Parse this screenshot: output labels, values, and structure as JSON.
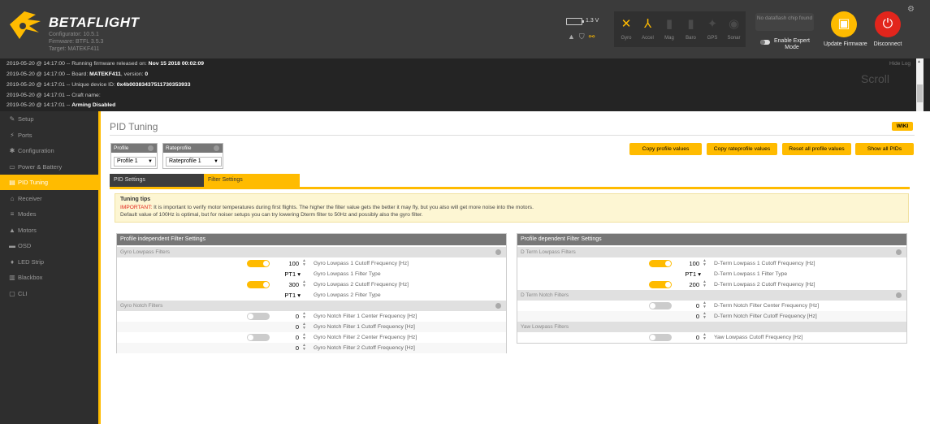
{
  "header": {
    "brand": "BETAFLIGHT",
    "meta": [
      "Configurator: 10.5.1",
      "Firmware: BTFL 3.5.3",
      "Target: MATEKF411"
    ],
    "battery_voltage": "1.3 V",
    "sensors": [
      {
        "label": "Gyro",
        "icon": "gyro-icon",
        "glyph": "✕",
        "active": true
      },
      {
        "label": "Accel",
        "icon": "accel-icon",
        "glyph": "⅄",
        "active": true
      },
      {
        "label": "Mag",
        "icon": "mag-icon",
        "glyph": "▮",
        "active": false
      },
      {
        "label": "Baro",
        "icon": "baro-icon",
        "glyph": "▮",
        "active": false
      },
      {
        "label": "GPS",
        "icon": "gps-icon",
        "glyph": "✦",
        "active": false
      },
      {
        "label": "Sonar",
        "icon": "sonar-icon",
        "glyph": "◉",
        "active": false
      }
    ],
    "dataflash": "No dataflash chip found",
    "expert_mode": "Enable Expert Mode",
    "update_firmware": "Update Firmware",
    "disconnect": "Disconnect"
  },
  "log": {
    "lines": [
      {
        "prefix": "2019-05-20 @ 14:17:00 -- Running firmware released on: ",
        "bold": "Nov 15 2018 00:02:09"
      },
      {
        "prefix": "2019-05-20 @ 14:17:00 -- Board: ",
        "bold": "MATEKF411",
        "suffix": ", version: ",
        "bold2": "0"
      },
      {
        "prefix": "2019-05-20 @ 14:17:01 -- Unique device ID: ",
        "bold": "0x4b00383437511730353933"
      },
      {
        "prefix": "2019-05-20 @ 14:17:01 -- Craft name: ",
        "bold": ""
      },
      {
        "prefix": "2019-05-20 @ 14:17:01 -- ",
        "bold": "Arming Disabled"
      }
    ],
    "hide_log": "Hide Log",
    "scroll": "Scroll"
  },
  "sidebar": {
    "items": [
      {
        "label": "Setup",
        "icon": "wrench-icon",
        "glyph": "✎",
        "active": false
      },
      {
        "label": "Ports",
        "icon": "plug-icon",
        "glyph": "⚡",
        "active": false
      },
      {
        "label": "Configuration",
        "icon": "gear-icon",
        "glyph": "✱",
        "active": false
      },
      {
        "label": "Power & Battery",
        "icon": "battery-icon",
        "glyph": "▭",
        "active": false
      },
      {
        "label": "PID Tuning",
        "icon": "pid-icon",
        "glyph": "▤",
        "active": true
      },
      {
        "label": "Receiver",
        "icon": "receiver-icon",
        "glyph": "⌂",
        "active": false
      },
      {
        "label": "Modes",
        "icon": "modes-icon",
        "glyph": "≡",
        "active": false
      },
      {
        "label": "Motors",
        "icon": "motors-icon",
        "glyph": "▲",
        "active": false
      },
      {
        "label": "OSD",
        "icon": "osd-icon",
        "glyph": "▬",
        "active": false
      },
      {
        "label": "LED Strip",
        "icon": "led-icon",
        "glyph": "♦",
        "active": false
      },
      {
        "label": "Blackbox",
        "icon": "blackbox-icon",
        "glyph": "▥",
        "active": false
      },
      {
        "label": "CLI",
        "icon": "cli-icon",
        "glyph": "▢",
        "active": false
      }
    ]
  },
  "main": {
    "title": "PID Tuning",
    "wiki": "WIKI",
    "profile": {
      "label": "Profile",
      "value": "Profile 1"
    },
    "rateprofile": {
      "label": "Rateprofile",
      "value": "Rateprofile 1"
    },
    "buttons": {
      "copy_profile": "Copy profile values",
      "copy_rateprofile": "Copy rateprofile values",
      "reset_all": "Reset all profile values",
      "show_all": "Show all PIDs"
    },
    "tabs": {
      "pid": "PID Settings",
      "filter": "Filter Settings"
    },
    "tips": {
      "title": "Tuning tips",
      "important": "IMPORTANT:",
      "line1": " It is important to verify motor temperatures during first flights. The higher the filter value gets the better it may fly, but you also will get more noise into the motors.",
      "line2": "Default value of 100Hz is optimal, but for noiser setups you can try lowering Dterm filter to 50Hz and possibly also the gyro filter."
    },
    "left_panel": {
      "title": "Profile independent Filter Settings",
      "gyro_lowpass": "Gyro Lowpass Filters",
      "gyro_notch": "Gyro Notch Filters",
      "lp1_cutoff": {
        "value": "100",
        "label": "Gyro Lowpass 1 Cutoff Frequency [Hz]"
      },
      "lp1_type": {
        "value": "PT1",
        "label": "Gyro Lowpass 1 Filter Type"
      },
      "lp2_cutoff": {
        "value": "300",
        "label": "Gyro Lowpass 2 Cutoff Frequency [Hz]"
      },
      "lp2_type": {
        "value": "PT1",
        "label": "Gyro Lowpass 2 Filter Type"
      },
      "n1_center": {
        "value": "0",
        "label": "Gyro Notch Filter 1 Center Frequency [Hz]"
      },
      "n1_cutoff": {
        "value": "0",
        "label": "Gyro Notch Filter 1 Cutoff Frequency [Hz]"
      },
      "n2_center": {
        "value": "0",
        "label": "Gyro Notch Filter 2 Center Frequency [Hz]"
      },
      "n2_cutoff": {
        "value": "0",
        "label": "Gyro Notch Filter 2 Cutoff Frequency [Hz]"
      }
    },
    "right_panel": {
      "title": "Profile dependent Filter Settings",
      "dterm_lowpass": "D Term Lowpass Filters",
      "dterm_notch": "D Term Notch Filters",
      "yaw_lowpass": "Yaw Lowpass Filters",
      "lp1_cutoff": {
        "value": "100",
        "label": "D-Term Lowpass 1 Cutoff Frequency [Hz]"
      },
      "lp1_type": {
        "value": "PT1",
        "label": "D-Term Lowpass 1 Filter Type"
      },
      "lp2_cutoff": {
        "value": "200",
        "label": "D-Term Lowpass 2 Cutoff Frequency [Hz]"
      },
      "notch_center": {
        "value": "0",
        "label": "D-Term Notch Filter Center Frequency [Hz]"
      },
      "notch_cutoff": {
        "value": "0",
        "label": "D-Term Notch Filter Cutoff Frequency [Hz]"
      },
      "yaw_cutoff": {
        "value": "0",
        "label": "Yaw Lowpass Cutoff Frequency [Hz]"
      }
    }
  },
  "colors": {
    "accent": "#ffbb00",
    "header": "#3b3b3b",
    "log": "#242424",
    "sidebar": "#2e2e2e",
    "update": "#ffbb00",
    "disconnect": "#e2251c"
  }
}
